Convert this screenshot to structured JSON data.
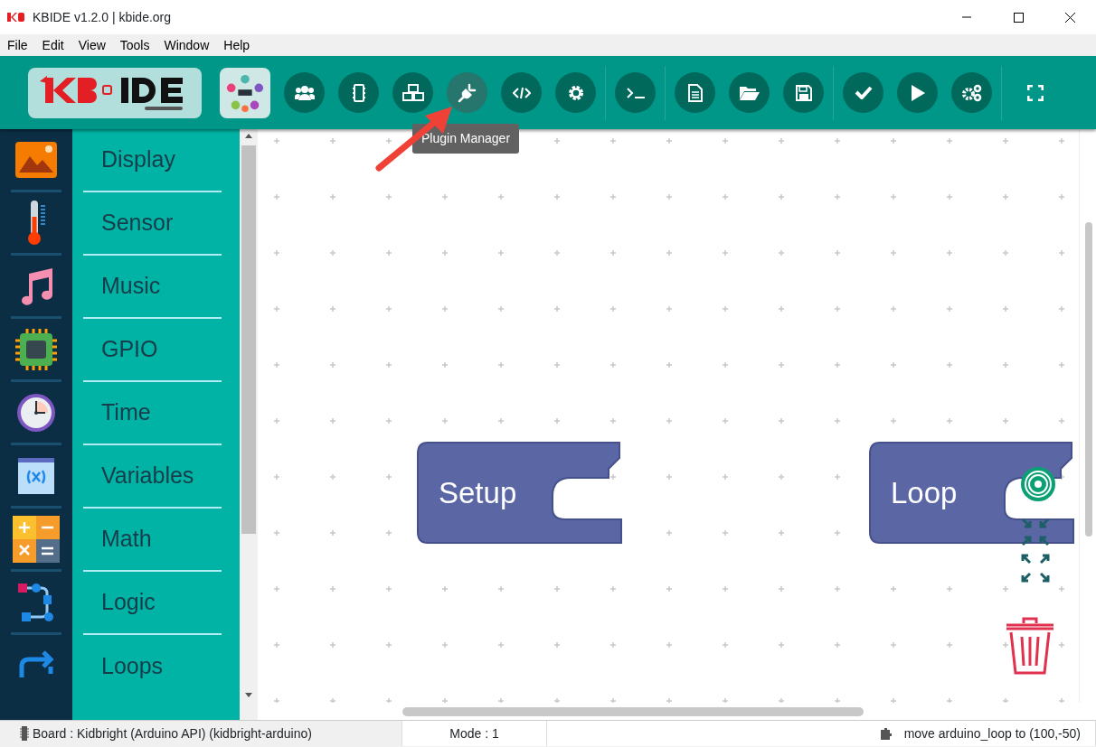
{
  "window": {
    "title": "KBIDE v1.2.0 | kbide.org"
  },
  "menu": [
    "File",
    "Edit",
    "View",
    "Tools",
    "Window",
    "Help"
  ],
  "toolbar": {
    "logo": {
      "kind": "kbide"
    },
    "groups": [
      [
        {
          "kind": "community",
          "hovered": false
        },
        {
          "kind": "users",
          "hovered": false
        },
        {
          "kind": "chip",
          "hovered": false
        },
        {
          "kind": "cubes",
          "hovered": false
        },
        {
          "kind": "plug",
          "hovered": true
        },
        {
          "kind": "code",
          "hovered": false
        },
        {
          "kind": "gear",
          "hovered": false
        }
      ],
      [
        {
          "kind": "terminal",
          "hovered": false
        }
      ],
      [
        {
          "kind": "file",
          "hovered": false
        },
        {
          "kind": "folder",
          "hovered": false
        },
        {
          "kind": "save",
          "hovered": false
        }
      ],
      [
        {
          "kind": "check",
          "hovered": false
        },
        {
          "kind": "play",
          "hovered": false
        },
        {
          "kind": "gears",
          "hovered": false
        }
      ],
      [
        {
          "kind": "fullscreen",
          "hovered": false
        }
      ]
    ]
  },
  "tooltip": "Plugin Manager",
  "categories": [
    {
      "label": "Display",
      "kind": "picture"
    },
    {
      "label": "Sensor",
      "kind": "thermometer"
    },
    {
      "label": "Music",
      "kind": "note"
    },
    {
      "label": "GPIO",
      "kind": "chip"
    },
    {
      "label": "Time",
      "kind": "clock"
    },
    {
      "label": "Variables",
      "kind": "variable"
    },
    {
      "label": "Math",
      "kind": "math"
    },
    {
      "label": "Logic",
      "kind": "flow"
    },
    {
      "label": "Loops",
      "kind": "loop"
    }
  ],
  "blocks": [
    {
      "label": "Setup"
    },
    {
      "label": "Loop"
    }
  ],
  "status_bar": {
    "board": "Board : Kidbright (Arduino API) (kidbright-arduino)",
    "mode": "Mode : 1",
    "message": "move arduino_loop to (100,-50)"
  }
}
